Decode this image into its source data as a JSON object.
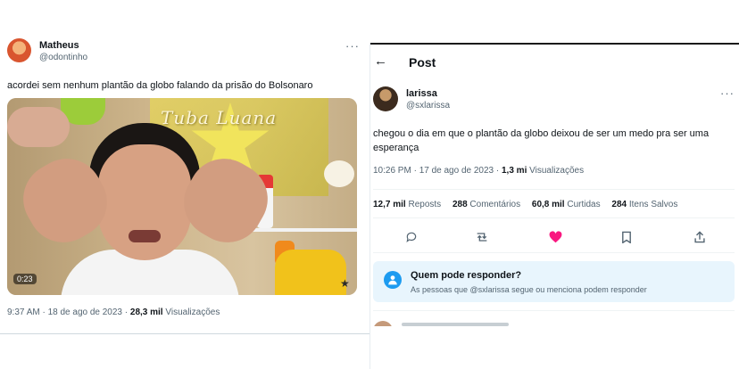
{
  "left_post": {
    "user_name": "Matheus",
    "user_handle": "@odontinho",
    "more_label": "···",
    "text": "acordei sem nenhum plantão da globo falando da prisão do Bolsonaro",
    "video": {
      "poster_text": "Tuba Luana",
      "duration": "0:23"
    },
    "meta": {
      "time_date": "9:37 AM · 18 de ago de 2023 · ",
      "views_count": "28,3 mil",
      "views_label": " Visualizações"
    }
  },
  "right_post": {
    "header": {
      "back_icon": "arrow-left-icon",
      "title": "Post"
    },
    "user_name": "larissa",
    "user_handle": "@sxlarissa",
    "more_label": "···",
    "text": "chegou o dia em que o plantão da globo deixou de ser um medo pra ser uma esperança",
    "meta": {
      "time_date": "10:26 PM · 17 de ago de 2023 · ",
      "views_count": "1,3 mi",
      "views_label": " Visualizações"
    },
    "stats": {
      "reposts_count": "12,7 mil",
      "reposts_label": " Reposts",
      "comments_count": "288",
      "comments_label": " Comentários",
      "likes_count": "60,8 mil",
      "likes_label": " Curtidas",
      "saves_count": "284",
      "saves_label": " Itens Salvos"
    },
    "actions": [
      "reply-icon",
      "repost-icon",
      "like-icon",
      "bookmark-icon",
      "share-icon"
    ],
    "like_color": "#f91880",
    "reply_restriction": {
      "title": "Quem pode responder?",
      "text": "As pessoas que @sxlarissa segue ou menciona podem responder"
    }
  }
}
